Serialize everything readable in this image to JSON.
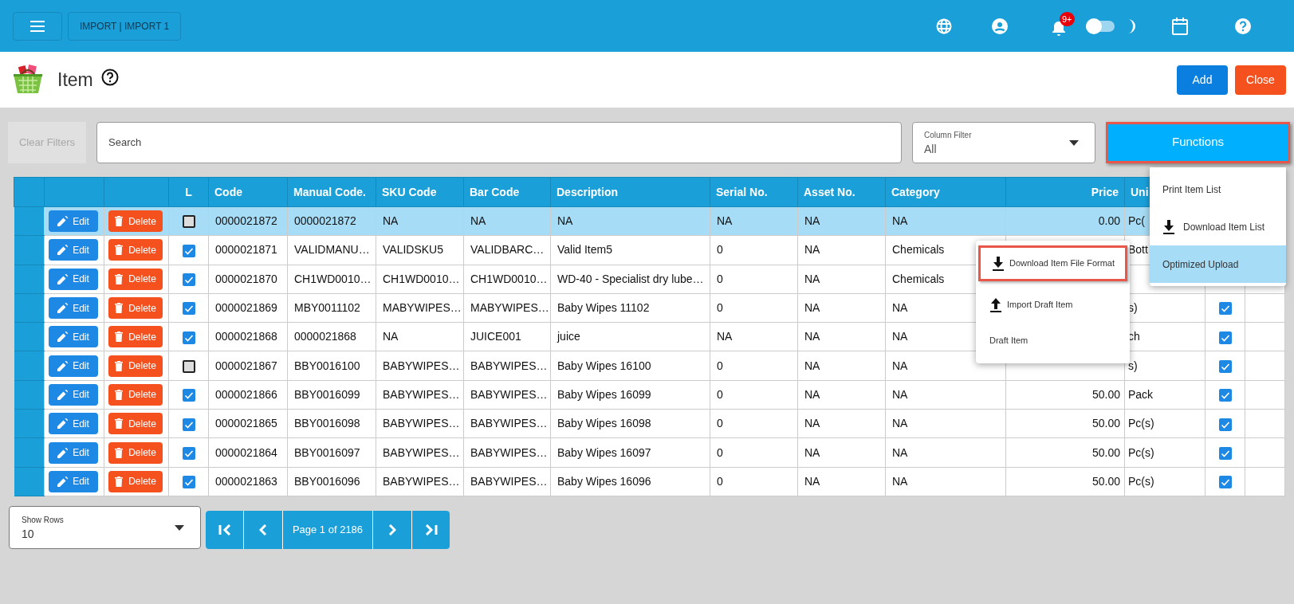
{
  "top_bar": {
    "breadcrumb": "IMPORT | IMPORT 1",
    "notification_badge": "9+",
    "dark_mode": false
  },
  "header": {
    "title": "Item",
    "buttons": [
      {
        "label": "Add",
        "kind": "add"
      },
      {
        "label": "Close",
        "kind": "close"
      }
    ]
  },
  "filters": {
    "clear_button": {
      "label": "Clear Filters",
      "disabled": true
    },
    "search_placeholder": "Search",
    "column_filter": {
      "label": "Column Filter",
      "value": "All"
    },
    "functions_button": "Functions"
  },
  "table": {
    "l_header": "L",
    "columns": [
      "Code",
      "Manual Code.",
      "SKU Code",
      "Bar Code",
      "Description",
      "Serial No.",
      "Asset No.",
      "Category"
    ],
    "price_header": "Price",
    "unit_header": "Uni",
    "rows": [
      {
        "selected": true,
        "actions": [
          "Edit",
          "Delete"
        ],
        "l_checked": false,
        "cells": [
          "0000021872",
          "0000021872",
          "NA",
          "NA",
          "NA",
          "NA",
          "NA",
          "NA"
        ],
        "price": "0.00",
        "unit": "Pc("
      },
      {
        "selected": false,
        "actions": [
          "Edit",
          "Delete"
        ],
        "l_checked": true,
        "cells": [
          "0000021871",
          "VALIDMANU…",
          "VALIDSKU5",
          "VALIDBARC…",
          "Valid Item5",
          "0",
          "NA",
          "Chemicals"
        ],
        "unit": "Bott"
      },
      {
        "selected": false,
        "actions": [
          "Edit",
          "Delete"
        ],
        "l_checked": true,
        "cells": [
          "0000021870",
          "CH1WD0010…",
          "CH1WD0010…",
          "CH1WD0010…",
          "WD-40 - Specialist dry lube…",
          "0",
          "NA",
          "Chemicals"
        ]
      },
      {
        "selected": false,
        "actions": [
          "Edit",
          "Delete"
        ],
        "l_checked": true,
        "cells": [
          "0000021869",
          "MBY0011102",
          "MABYWIPES…",
          "MABYWIPES…",
          "Baby Wipes 11102",
          "0",
          "NA",
          "NA"
        ],
        "unit": "s)",
        "active": true
      },
      {
        "selected": false,
        "actions": [
          "Edit",
          "Delete"
        ],
        "l_checked": true,
        "cells": [
          "0000021868",
          "0000021868",
          "NA",
          "JUICE001",
          "juice",
          "NA",
          "NA",
          "NA"
        ],
        "unit": "ch",
        "active": true
      },
      {
        "selected": false,
        "actions": [
          "Edit",
          "Delete"
        ],
        "l_checked": false,
        "cells": [
          "0000021867",
          "BBY0016100",
          "BABYWIPES…",
          "BABYWIPES…",
          "Baby Wipes 16100",
          "0",
          "NA",
          "NA"
        ],
        "unit": "s)",
        "active": true
      },
      {
        "selected": false,
        "actions": [
          "Edit",
          "Delete"
        ],
        "l_checked": true,
        "cells": [
          "0000021866",
          "BBY0016099",
          "BABYWIPES…",
          "BABYWIPES…",
          "Baby Wipes 16099",
          "0",
          "NA",
          "NA"
        ],
        "price": "50.00",
        "unit": "Pack",
        "active": true
      },
      {
        "selected": false,
        "actions": [
          "Edit",
          "Delete"
        ],
        "l_checked": true,
        "cells": [
          "0000021865",
          "BBY0016098",
          "BABYWIPES…",
          "BABYWIPES…",
          "Baby Wipes 16098",
          "0",
          "NA",
          "NA"
        ],
        "price": "50.00",
        "unit": "Pc(s)",
        "active": true
      },
      {
        "selected": false,
        "actions": [
          "Edit",
          "Delete"
        ],
        "l_checked": true,
        "cells": [
          "0000021864",
          "BBY0016097",
          "BABYWIPES…",
          "BABYWIPES…",
          "Baby Wipes 16097",
          "0",
          "NA",
          "NA"
        ],
        "price": "50.00",
        "unit": "Pc(s)",
        "active": true
      },
      {
        "selected": false,
        "actions": [
          "Edit",
          "Delete"
        ],
        "l_checked": true,
        "cells": [
          "0000021863",
          "BBY0016096",
          "BABYWIPES…",
          "BABYWIPES…",
          "Baby Wipes 16096",
          "0",
          "NA",
          "NA"
        ],
        "price": "50.00",
        "unit": "Pc(s)",
        "active": true
      }
    ]
  },
  "functions_menu": {
    "items": [
      {
        "label": "Print Item List",
        "kind": "plain",
        "selected": false
      },
      {
        "label": "Download Item List",
        "kind": "download",
        "selected": false
      },
      {
        "label": "Optimized Upload",
        "kind": "plain",
        "selected": true
      }
    ]
  },
  "submenu": {
    "items": [
      {
        "label": "Download Item File Format",
        "kind": "download",
        "outlined": true
      },
      {
        "label": "Import Draft Item",
        "kind": "upload",
        "outlined": false
      },
      {
        "label": "Draft Item",
        "kind": "plain",
        "outlined": false
      }
    ]
  },
  "pagination": {
    "show_rows": {
      "label": "Show Rows",
      "value": "10"
    },
    "page_label": "Page 1 of 2186"
  }
}
